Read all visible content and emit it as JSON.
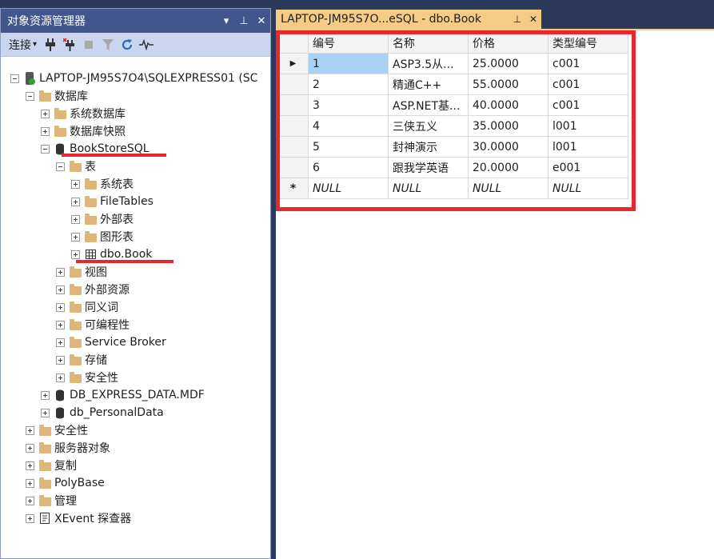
{
  "object_explorer": {
    "title": "对象资源管理器",
    "title_buttons": [
      "▾",
      "⊥",
      "✕"
    ],
    "toolbar": {
      "connect_label": "连接",
      "connect_caret": "▾"
    },
    "tree": {
      "server": "LAPTOP-JM95S7O4\\SQLEXPRESS01 (SC",
      "databases": "数据库",
      "system_databases": "系统数据库",
      "db_snapshots": "数据库快照",
      "bookstore": "BookStoreSQL",
      "tables": "表",
      "system_tables": "系统表",
      "file_tables": "FileTables",
      "external_tables": "外部表",
      "graph_tables": "图形表",
      "dbo_book": "dbo.Book",
      "views": "视图",
      "external_resources": "外部资源",
      "synonyms": "同义词",
      "programmability": "可编程性",
      "service_broker": "Service Broker",
      "storage": "存储",
      "db_security": "安全性",
      "db_express_data": "DB_EXPRESS_DATA.MDF",
      "db_personal": "db_PersonalData",
      "security": "安全性",
      "server_objects": "服务器对象",
      "replication": "复制",
      "polybase": "PolyBase",
      "management": "管理",
      "xevent": "XEvent 探查器"
    }
  },
  "document": {
    "tab_label": "LAPTOP-JM95S7O...eSQL - dbo.Book",
    "tab_pin": "⊥",
    "tab_close": "✕"
  },
  "grid": {
    "columns": [
      "编号",
      "名称",
      "价格",
      "类型编号"
    ],
    "rows": [
      {
        "marker": "▶",
        "cells": [
          "1",
          "ASP3.5从...",
          "25.0000",
          "c001"
        ]
      },
      {
        "marker": "",
        "cells": [
          "2",
          "精通C++",
          "55.0000",
          "c001"
        ]
      },
      {
        "marker": "",
        "cells": [
          "3",
          "ASP.NET基...",
          "40.0000",
          "c001"
        ]
      },
      {
        "marker": "",
        "cells": [
          "4",
          "三侠五义",
          "35.0000",
          "l001"
        ]
      },
      {
        "marker": "",
        "cells": [
          "5",
          "封神演示",
          "30.0000",
          "l001"
        ]
      },
      {
        "marker": "",
        "cells": [
          "6",
          "跟我学英语",
          "20.0000",
          "e001"
        ]
      },
      {
        "marker": "*",
        "cells": [
          "NULL",
          "NULL",
          "NULL",
          "NULL"
        ]
      }
    ]
  },
  "colors": {
    "title_bar": "#40568d",
    "toolbar": "#ccd5f0",
    "doc_tab": "#f5cc84",
    "annotation_red": "#e8282e",
    "selected_cell": "#a9d1f3"
  }
}
